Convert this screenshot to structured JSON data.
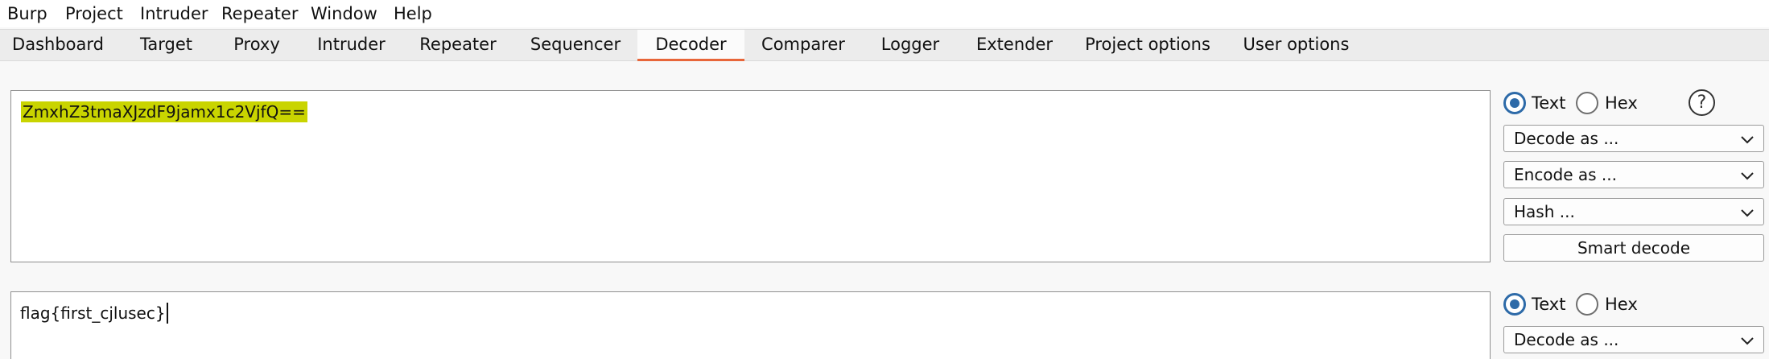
{
  "menu": [
    "Burp",
    "Project",
    "Intruder",
    "Repeater",
    "Window",
    "Help"
  ],
  "tabs": [
    "Dashboard",
    "Target",
    "Proxy",
    "Intruder",
    "Repeater",
    "Sequencer",
    "Decoder",
    "Comparer",
    "Logger",
    "Extender",
    "Project options",
    "User options"
  ],
  "active_tab": "Decoder",
  "accent_color": "#e8663a",
  "highlight_color": "#c9d400",
  "decoder": {
    "input_text": "ZmxhZ3tmaXJzdF9jamx1c2VjfQ==",
    "output_text": "flag{first_cjlusec}",
    "panel1": {
      "text_label": "Text",
      "hex_label": "Hex",
      "selected": "Text",
      "help_symbol": "?",
      "decode_label": "Decode as ...",
      "encode_label": "Encode as ...",
      "hash_label": "Hash ...",
      "smart_decode_label": "Smart decode"
    },
    "panel2": {
      "text_label": "Text",
      "hex_label": "Hex",
      "selected": "Text",
      "decode_label": "Decode as ..."
    }
  }
}
